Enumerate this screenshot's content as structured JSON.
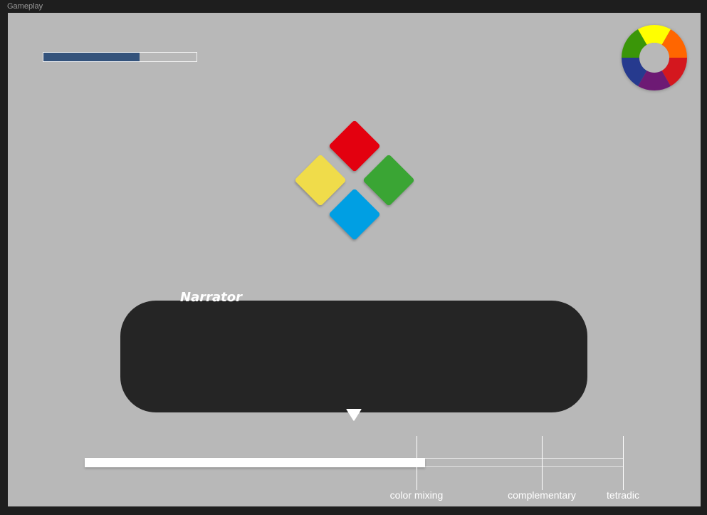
{
  "window": {
    "title": "Gameplay"
  },
  "health_bar": {
    "fraction": 0.63,
    "fill_color": "#34537c",
    "track_color": "#f2f2f2"
  },
  "color_wheel": {
    "segments": [
      {
        "name": "yellow",
        "color": "#ffff00"
      },
      {
        "name": "orange",
        "color": "#ff6600"
      },
      {
        "name": "red",
        "color": "#d4171e"
      },
      {
        "name": "purple",
        "color": "#6d1a74"
      },
      {
        "name": "blue",
        "color": "#263a8e"
      },
      {
        "name": "green",
        "color": "#3a9608"
      }
    ],
    "hub_color": "#b8b8b8"
  },
  "gems": [
    {
      "name": "red-gem",
      "color": "#e3000f"
    },
    {
      "name": "yellow-gem",
      "color": "#f0dc4a"
    },
    {
      "name": "green-gem",
      "color": "#3aa534"
    },
    {
      "name": "blue-gem",
      "color": "#009fe3"
    }
  ],
  "dialog": {
    "speaker": "Narrator",
    "text": "",
    "continue_icon": "triangle-down-icon"
  },
  "progress": {
    "fraction": 0.632,
    "milestones": [
      {
        "label": "color mixing",
        "fraction": 0.616
      },
      {
        "label": "complementary",
        "fraction": 0.849
      },
      {
        "label": "tetradic",
        "fraction": 1.0
      }
    ]
  }
}
